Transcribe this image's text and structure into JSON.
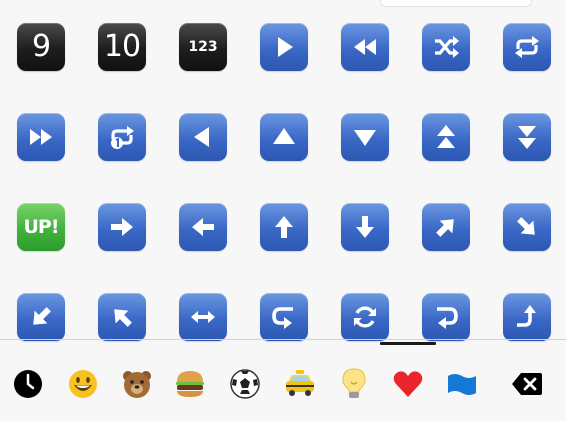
{
  "emoji_keyboard": {
    "grid": [
      {
        "name": "keycap-9-key",
        "kind": "text",
        "label": "9"
      },
      {
        "name": "keycap-10-key",
        "kind": "text",
        "label": "10"
      },
      {
        "name": "input-numbers-key",
        "kind": "text",
        "label": "123"
      },
      {
        "name": "play-button-key",
        "kind": "icon",
        "icon": "play-icon"
      },
      {
        "name": "fast-reverse-key",
        "kind": "icon",
        "icon": "fast-reverse-icon"
      },
      {
        "name": "shuffle-key",
        "kind": "icon",
        "icon": "shuffle-icon"
      },
      {
        "name": "repeat-key",
        "kind": "icon",
        "icon": "repeat-icon"
      },
      {
        "name": "fast-forward-key",
        "kind": "icon",
        "icon": "fast-forward-icon"
      },
      {
        "name": "repeat-single-key",
        "kind": "icon",
        "icon": "repeat-single-icon"
      },
      {
        "name": "reverse-key",
        "kind": "icon",
        "icon": "reverse-icon"
      },
      {
        "name": "up-triangle-key",
        "kind": "icon",
        "icon": "up-triangle-icon"
      },
      {
        "name": "down-triangle-key",
        "kind": "icon",
        "icon": "down-triangle-icon"
      },
      {
        "name": "fast-up-key",
        "kind": "icon",
        "icon": "fast-up-icon"
      },
      {
        "name": "fast-down-key",
        "kind": "icon",
        "icon": "fast-down-icon"
      },
      {
        "name": "up-button-key",
        "kind": "text",
        "label": "UP!"
      },
      {
        "name": "right-arrow-key",
        "kind": "icon",
        "icon": "arrow-right-icon"
      },
      {
        "name": "left-arrow-key",
        "kind": "icon",
        "icon": "arrow-left-icon"
      },
      {
        "name": "up-arrow-key",
        "kind": "icon",
        "icon": "arrow-up-icon"
      },
      {
        "name": "down-arrow-key",
        "kind": "icon",
        "icon": "arrow-down-icon"
      },
      {
        "name": "up-right-arrow-key",
        "kind": "icon",
        "icon": "arrow-up-right-icon"
      },
      {
        "name": "down-right-arrow-key",
        "kind": "icon",
        "icon": "arrow-down-right-icon"
      },
      {
        "name": "down-left-arrow-key",
        "kind": "icon",
        "icon": "arrow-down-left-icon"
      },
      {
        "name": "up-left-arrow-key",
        "kind": "icon",
        "icon": "arrow-up-left-icon"
      },
      {
        "name": "left-right-arrow-key",
        "kind": "icon",
        "icon": "arrow-left-right-icon"
      },
      {
        "name": "right-curving-left-key",
        "kind": "icon",
        "icon": "right-arrow-curving-left-icon"
      },
      {
        "name": "refresh-key",
        "kind": "icon",
        "icon": "anticlockwise-arrows-icon"
      },
      {
        "name": "left-curving-right-key",
        "kind": "icon",
        "icon": "left-arrow-curving-right-icon"
      },
      {
        "name": "right-curving-up-key",
        "kind": "icon",
        "icon": "right-arrow-curving-up-icon"
      }
    ],
    "categories": [
      {
        "name": "category-recent",
        "icon": "clock-icon"
      },
      {
        "name": "category-smileys",
        "icon": "smiley-face-icon"
      },
      {
        "name": "category-animals",
        "icon": "bear-face-icon"
      },
      {
        "name": "category-food",
        "icon": "hamburger-icon"
      },
      {
        "name": "category-activity",
        "icon": "soccer-ball-icon"
      },
      {
        "name": "category-travel",
        "icon": "taxi-icon"
      },
      {
        "name": "category-objects",
        "icon": "light-bulb-icon"
      },
      {
        "name": "category-symbols",
        "icon": "heart-icon"
      },
      {
        "name": "category-flags",
        "icon": "flag-icon"
      },
      {
        "name": "delete-button",
        "icon": "backspace-icon"
      }
    ],
    "colors": {
      "key_blue": "#3a68c6",
      "key_dark": "#1d1d1d",
      "key_green": "#41b33b",
      "background": "#f7f7f7"
    }
  }
}
